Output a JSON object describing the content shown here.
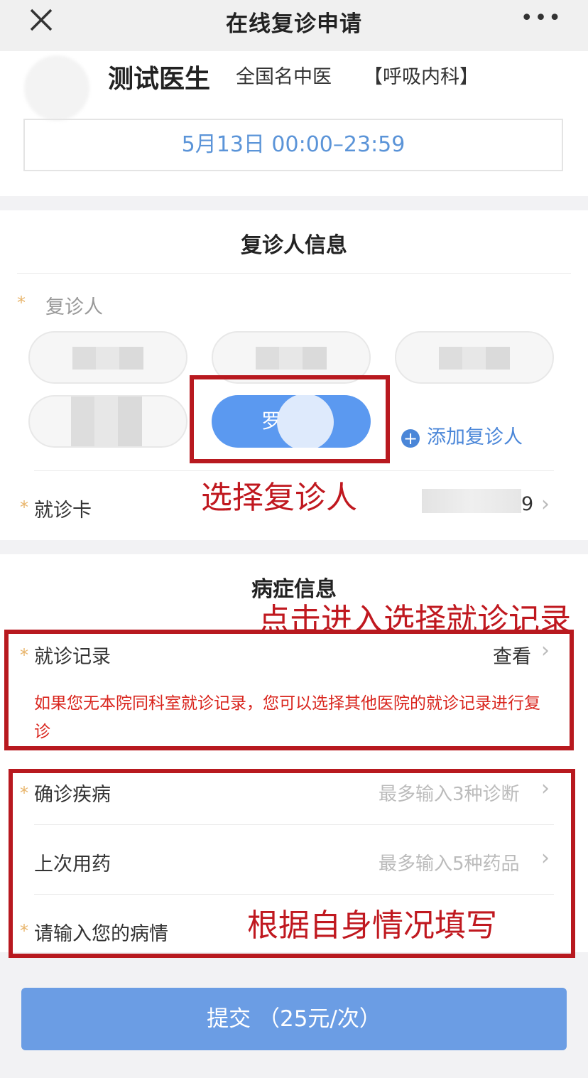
{
  "nav": {
    "title": "在线复诊申请",
    "close_icon": "close-icon",
    "more_icon": "more-icon"
  },
  "doctor": {
    "name": "测试医生",
    "title": "全国名中医",
    "dept": "【呼吸内科】",
    "time": "5月13日 00:00–23:59"
  },
  "patient_section": {
    "title": "复诊人信息",
    "patient_label": "复诊人",
    "selected_patient_partial": "罗",
    "add_patient": "添加复诊人",
    "card_label": "就诊卡",
    "card_value_suffix": "9",
    "annotation": "选择复诊人"
  },
  "illness_section": {
    "title": "病症信息",
    "record_label": "就诊记录",
    "record_action": "查看",
    "record_note": "如果您无本院同科室就诊记录，您可以选择其他医院的就诊记录进行复诊",
    "record_annotation": "点击进入选择就诊记录",
    "diagnosis_label": "确诊疾病",
    "diagnosis_placeholder": "最多输入3种诊断",
    "medication_label": "上次用药",
    "medication_placeholder": "最多输入5种药品",
    "condition_label": "请输入您的病情",
    "fill_annotation": "根据自身情况填写"
  },
  "submit": {
    "label": "提交 （25元/次）"
  },
  "colors": {
    "accent": "#5b99f0",
    "annotation": "#c0181f",
    "required_star": "#e8b46a",
    "warning": "#d9251d"
  }
}
